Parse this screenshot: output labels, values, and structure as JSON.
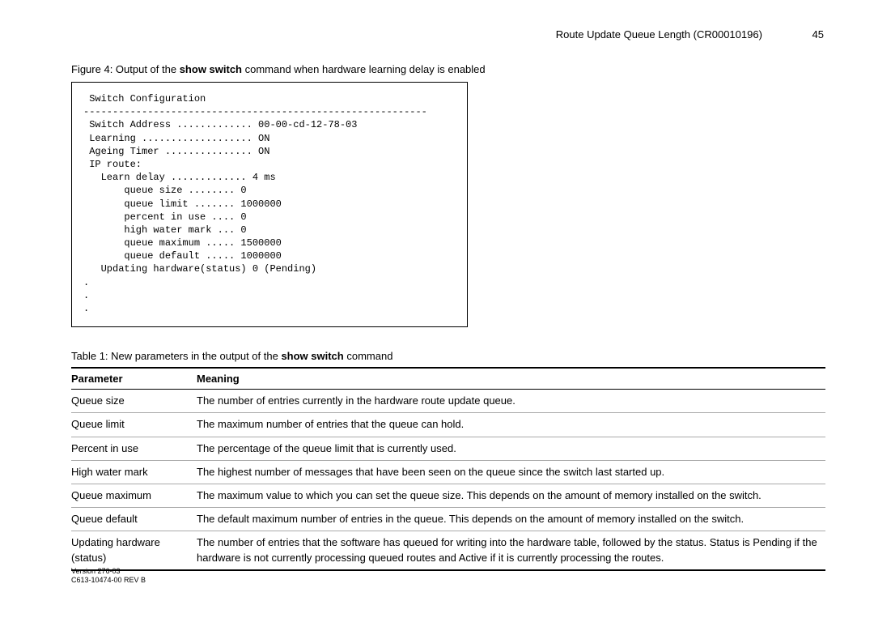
{
  "header": {
    "title": "Route Update Queue Length (CR00010196)",
    "page": "45"
  },
  "figure": {
    "caption_prefix": "Figure 4: Output of the ",
    "caption_cmd": "show switch",
    "caption_suffix": " command when hardware learning delay is enabled",
    "code": " Switch Configuration\n-----------------------------------------------------------\n Switch Address ............. 00-00-cd-12-78-03\n Learning ................... ON\n Ageing Timer ............... ON\n IP route:\n   Learn delay ............. 4 ms\n       queue size ........ 0\n       queue limit ....... 1000000\n       percent in use .... 0\n       high water mark ... 0\n       queue maximum ..... 1500000\n       queue default ..... 1000000\n   Updating hardware(status) 0 (Pending)\n.\n.\n."
  },
  "table": {
    "caption_prefix": "Table 1: New parameters in the output of the ",
    "caption_cmd": "show switch",
    "caption_suffix": " command",
    "head_param": "Parameter",
    "head_meaning": "Meaning",
    "rows": [
      {
        "param": "Queue size",
        "meaning": "The number of entries currently in the hardware route update queue."
      },
      {
        "param": "Queue limit",
        "meaning": "The maximum number of entries that the queue can hold."
      },
      {
        "param": "Percent in use",
        "meaning": "The percentage of the queue limit that is currently used."
      },
      {
        "param": "High water mark",
        "meaning": "The highest number of messages that have been seen on the queue since the switch last started up."
      },
      {
        "param": "Queue maximum",
        "meaning": "The maximum value to which you can set the queue size. This depends on the amount of memory installed on the switch."
      },
      {
        "param": "Queue default",
        "meaning": "The default maximum number of entries in the queue. This depends on the amount of memory installed on the switch."
      },
      {
        "param": "Updating hardware (status)",
        "meaning": "The number of entries that the software has queued for writing into the hardware table, followed by the status. Status is Pending if the hardware is not currently processing queued routes and Active if it is currently processing the routes."
      }
    ]
  },
  "footer": {
    "line1": "Version 276-03",
    "line2": "C613-10474-00 REV B"
  }
}
